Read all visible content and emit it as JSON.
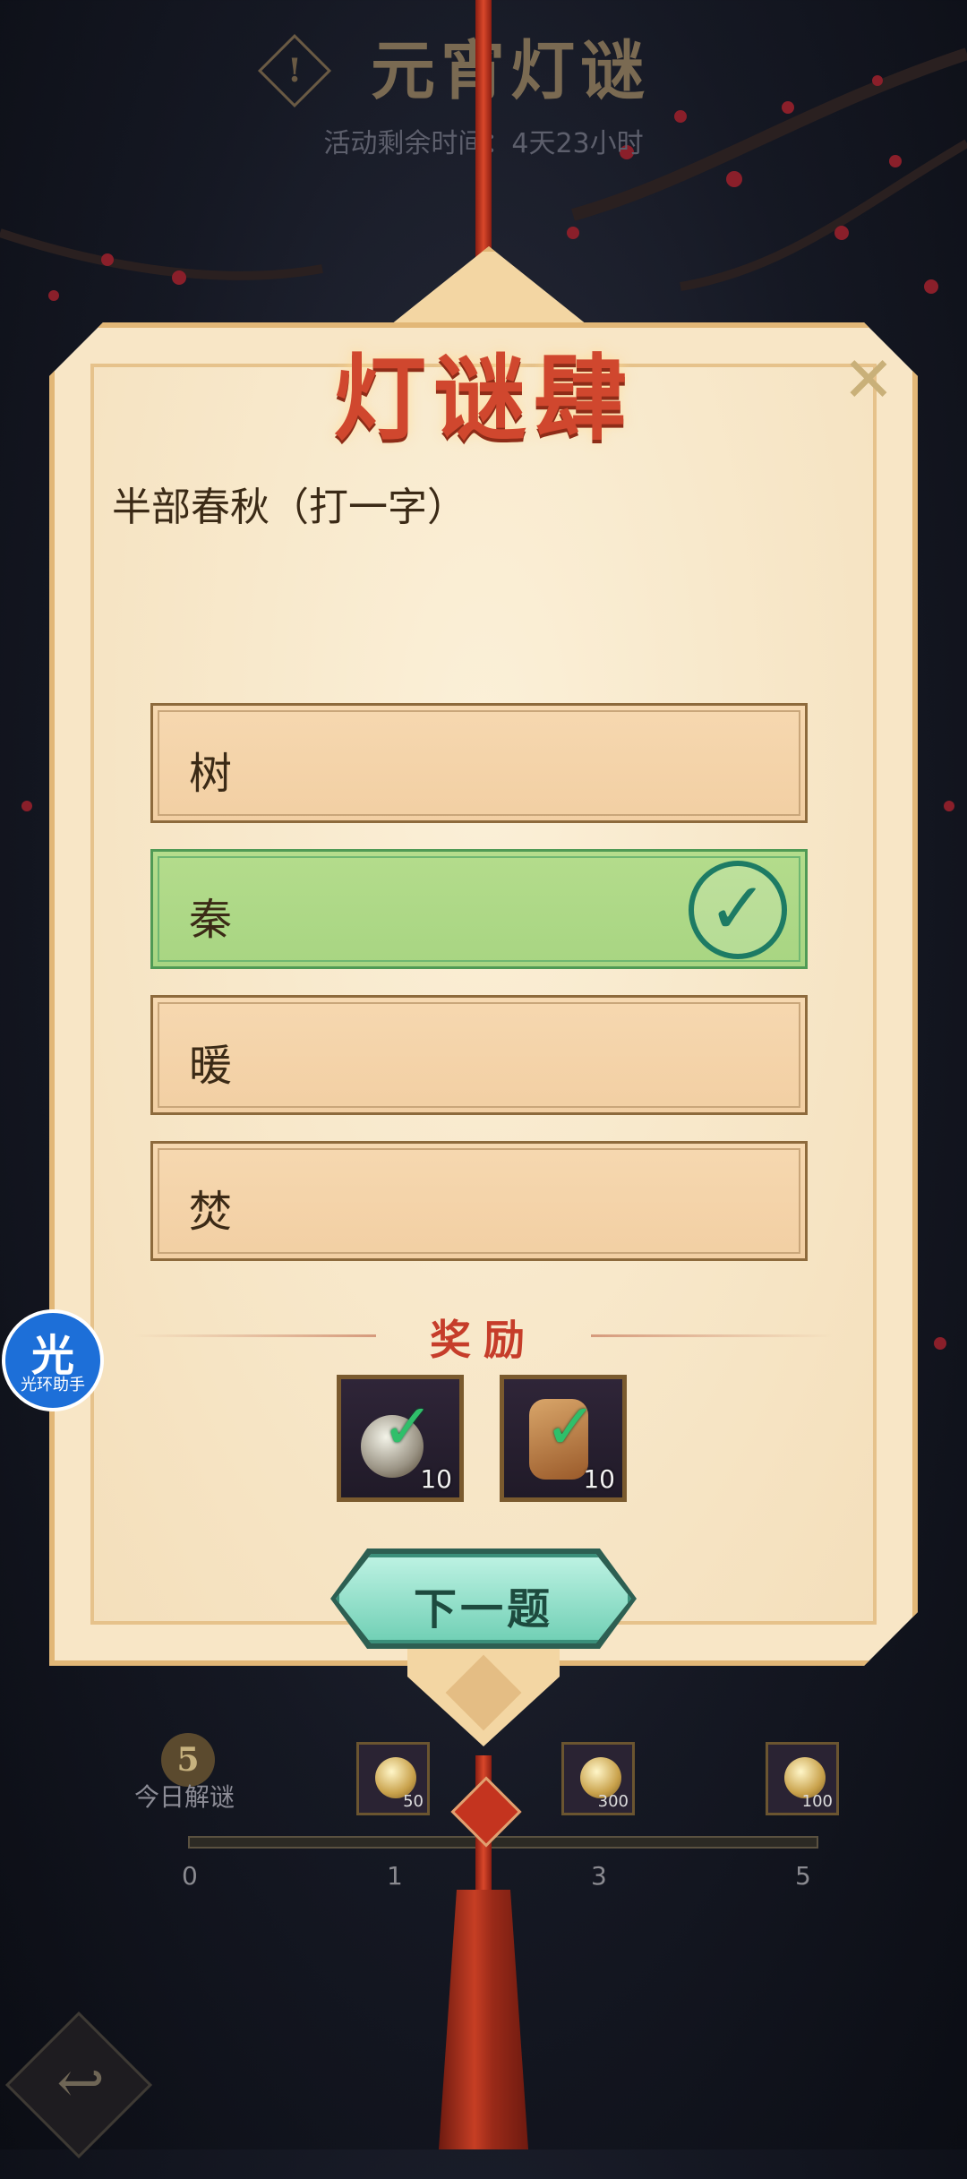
{
  "header": {
    "title": "元宵灯谜",
    "timer_label": "活动剩余时间：",
    "timer_value": "4天23小时"
  },
  "card": {
    "title": "灯谜肆",
    "question": "半部春秋（打一字）",
    "options": [
      {
        "label": "树",
        "state": "normal"
      },
      {
        "label": "秦",
        "state": "correct"
      },
      {
        "label": "暖",
        "state": "normal"
      },
      {
        "label": "焚",
        "state": "normal"
      }
    ],
    "reward_title": "奖励",
    "rewards": [
      {
        "icon": "coin-token-icon",
        "count": "10"
      },
      {
        "icon": "scroll-token-icon",
        "count": "10"
      }
    ],
    "next_button": "下一题",
    "close_icon": "close-icon"
  },
  "progress": {
    "today_count": "5",
    "today_label": "今日解谜",
    "ticks": [
      "0",
      "1",
      "3",
      "5"
    ],
    "milestone_counts": [
      "50",
      "300",
      "100"
    ]
  },
  "floating_assistant": {
    "glyph": "光",
    "label": "光环助手"
  },
  "colors": {
    "card_bg": "#f8e6c6",
    "title_red": "#d0472e",
    "correct_green": "#a8d582",
    "next_button": "#6fcfb4"
  }
}
